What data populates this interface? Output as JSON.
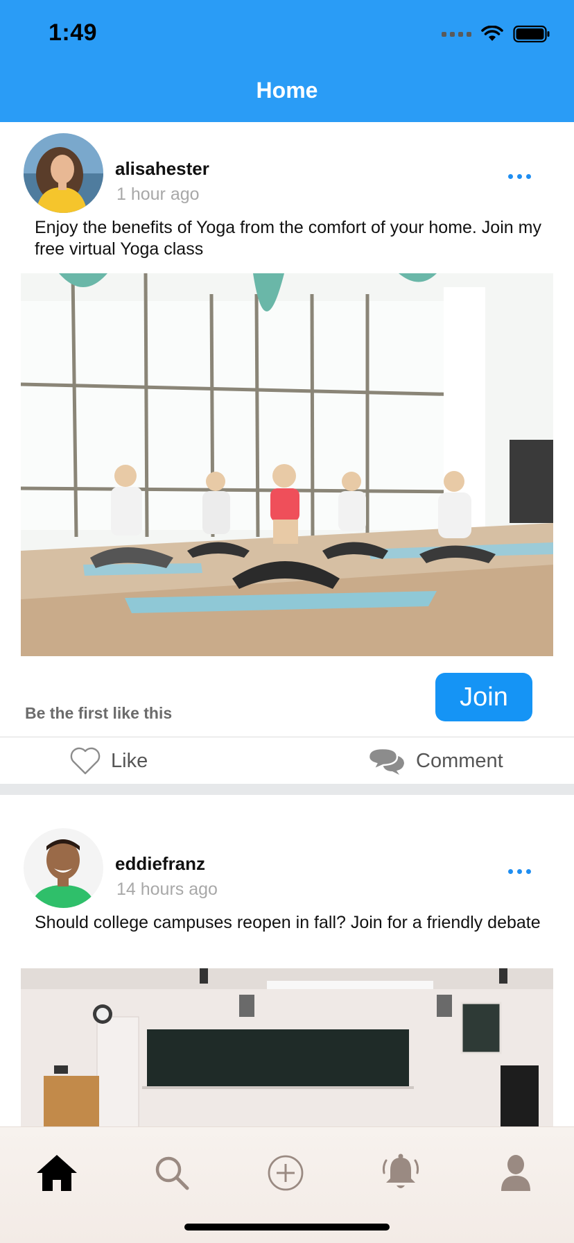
{
  "status_bar": {
    "time": "1:49"
  },
  "header": {
    "title": "Home"
  },
  "posts": [
    {
      "username": "alisahester",
      "time_ago": "1 hour ago",
      "text": "Enjoy the benefits of Yoga from the comfort of your home. Join my free virtual Yoga class",
      "likes_text": "Be the first like this",
      "join_label": "Join",
      "like_label": "Like",
      "comment_label": "Comment"
    },
    {
      "username": "eddiefranz",
      "time_ago": "14 hours ago",
      "text": "Should college campuses reopen in fall? Join for a friendly debate"
    }
  ],
  "tab_bar": {
    "items": [
      {
        "icon": "home-icon",
        "active": true
      },
      {
        "icon": "search-icon",
        "active": false
      },
      {
        "icon": "add-post-icon",
        "active": false
      },
      {
        "icon": "notifications-icon",
        "active": false
      },
      {
        "icon": "profile-icon",
        "active": false
      }
    ]
  },
  "colors": {
    "header_bg": "#2a9cf6",
    "accent": "#1594f5",
    "tab_icon": "#9a8a82"
  }
}
